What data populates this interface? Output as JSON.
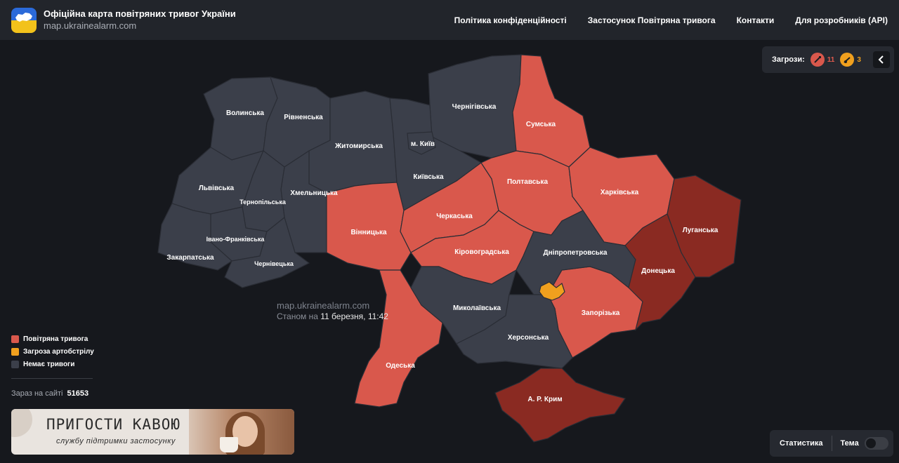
{
  "header": {
    "title": "Офіційна карта повітряних тривог України",
    "subtitle": "map.ukrainealarm.com",
    "nav": [
      "Політика конфіденційності",
      "Застосунок Повітряна тривога",
      "Контакти",
      "Для розробників (API)"
    ]
  },
  "threats": {
    "label": "Загрози:",
    "items": [
      {
        "icon": "rocket-icon",
        "count": "11",
        "color": "#e05a4d"
      },
      {
        "icon": "artillery-icon",
        "count": "3",
        "color": "#f0a01e"
      }
    ]
  },
  "colors": {
    "alert": "#d9584c",
    "artillery": "#f0a01e",
    "none": "#3b3f4a",
    "severe": "#8a2a22",
    "background": "#16181d"
  },
  "map": {
    "regions": [
      {
        "name": "Волинська",
        "status": "none"
      },
      {
        "name": "Рівненська",
        "status": "none"
      },
      {
        "name": "Житомирська",
        "status": "none"
      },
      {
        "name": "м. Київ",
        "status": "none"
      },
      {
        "name": "Чернігівська",
        "status": "none"
      },
      {
        "name": "Сумська",
        "status": "alert"
      },
      {
        "name": "Київська",
        "status": "none"
      },
      {
        "name": "Львівська",
        "status": "none"
      },
      {
        "name": "Хмельницька",
        "status": "none"
      },
      {
        "name": "Тернопільська",
        "status": "none"
      },
      {
        "name": "Полтавська",
        "status": "alert"
      },
      {
        "name": "Харківська",
        "status": "alert"
      },
      {
        "name": "Вінницька",
        "status": "alert"
      },
      {
        "name": "Черкаська",
        "status": "alert"
      },
      {
        "name": "Луганська",
        "status": "severe"
      },
      {
        "name": "Івано-Франківська",
        "status": "none"
      },
      {
        "name": "Дніпропетровська",
        "status": "none"
      },
      {
        "name": "Закарпатська",
        "status": "none"
      },
      {
        "name": "Кіровоградська",
        "status": "alert"
      },
      {
        "name": "Чернівецька",
        "status": "none"
      },
      {
        "name": "Донецька",
        "status": "severe"
      },
      {
        "name": "Миколаївська",
        "status": "none"
      },
      {
        "name": "Запорізька",
        "status": "alert"
      },
      {
        "name": "Херсонська",
        "status": "none"
      },
      {
        "name": "Одеська",
        "status": "alert"
      },
      {
        "name": "А. Р. Крим",
        "status": "severe"
      }
    ],
    "watermark_url": "map.ukrainealarm.com",
    "watermark_prefix": "Станом на",
    "watermark_date": "11 березня, 11:42"
  },
  "legend": {
    "items": [
      {
        "label": "Повітряна тривога",
        "color": "#d9584c"
      },
      {
        "label": "Загроза артобстрілу",
        "color": "#f0a01e"
      },
      {
        "label": "Немає тривоги",
        "color": "#3b3f4a"
      }
    ]
  },
  "online": {
    "label": "Зараз на сайті",
    "count": "51653"
  },
  "banner": {
    "line1": "ПРИГОСТИ КАВОЮ",
    "line2": "службу підтримки застосунку"
  },
  "footer": {
    "stats_label": "Статистика",
    "theme_label": "Тема"
  }
}
